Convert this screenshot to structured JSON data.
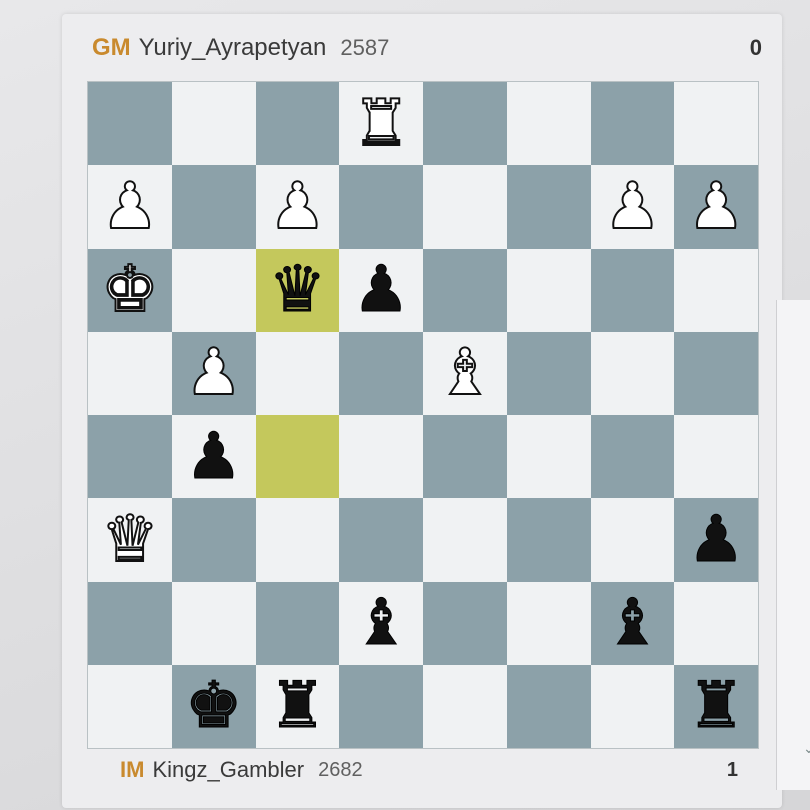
{
  "top_player": {
    "title": "GM",
    "name": "Yuriy_Ayrapetyan",
    "rating": "2587",
    "score": "0"
  },
  "bottom_player": {
    "title": "IM",
    "name": "Kingz_Gambler",
    "rating": "2682",
    "score": "1"
  },
  "board": {
    "highlight_squares": [
      "c6",
      "c4"
    ],
    "pieces": [
      {
        "square": "d8",
        "piece": "rook",
        "color": "white"
      },
      {
        "square": "a7",
        "piece": "pawn",
        "color": "white"
      },
      {
        "square": "c7",
        "piece": "pawn",
        "color": "white"
      },
      {
        "square": "g7",
        "piece": "pawn",
        "color": "white"
      },
      {
        "square": "h7",
        "piece": "pawn",
        "color": "white"
      },
      {
        "square": "a6",
        "piece": "king",
        "color": "white"
      },
      {
        "square": "c6",
        "piece": "queen",
        "color": "black"
      },
      {
        "square": "d6",
        "piece": "pawn",
        "color": "black"
      },
      {
        "square": "b5",
        "piece": "pawn",
        "color": "white"
      },
      {
        "square": "e5",
        "piece": "bishop",
        "color": "white"
      },
      {
        "square": "b4",
        "piece": "pawn",
        "color": "black"
      },
      {
        "square": "a3",
        "piece": "queen",
        "color": "white"
      },
      {
        "square": "h3",
        "piece": "pawn",
        "color": "black"
      },
      {
        "square": "d2",
        "piece": "bishop",
        "color": "black"
      },
      {
        "square": "g2",
        "piece": "bishop",
        "color": "black"
      },
      {
        "square": "b1",
        "piece": "king",
        "color": "black"
      },
      {
        "square": "c1",
        "piece": "rook",
        "color": "black"
      },
      {
        "square": "h1",
        "piece": "rook",
        "color": "black"
      }
    ]
  },
  "colors": {
    "light_square": "#f0f2f3",
    "dark_square": "#8ca1a9",
    "highlight": "#d6d670",
    "title_accent": "#c98a2e"
  }
}
